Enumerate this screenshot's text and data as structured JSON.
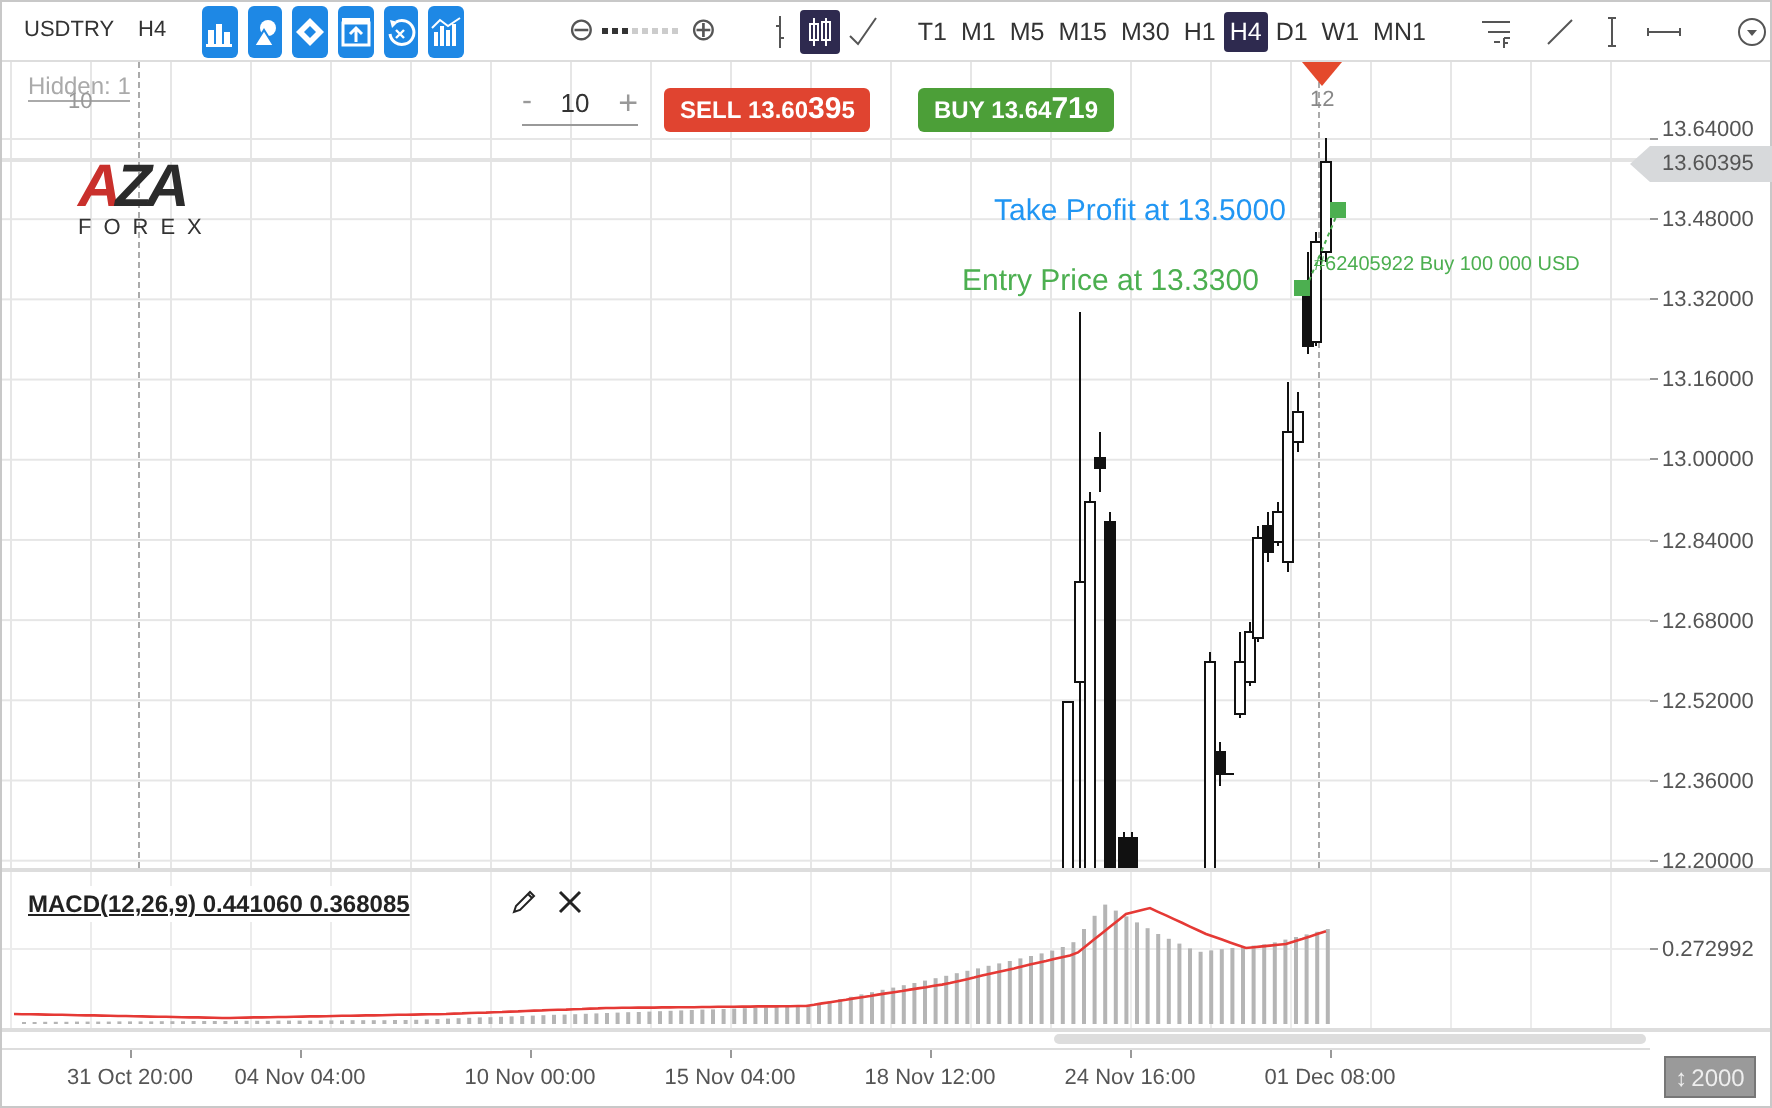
{
  "toolbar": {
    "symbol": "USDTRY",
    "timeframe": "H4",
    "tool_buttons": [
      {
        "kind": "bars"
      },
      {
        "kind": "shapes"
      },
      {
        "kind": "diamond"
      },
      {
        "kind": "upload"
      },
      {
        "kind": "refresh"
      },
      {
        "kind": "indicators"
      }
    ],
    "zoom": {
      "minus": "⊖",
      "plus": "⊕",
      "level": 0.375
    },
    "chart_types": [
      {
        "kind": "bar",
        "selected": false
      },
      {
        "kind": "candle",
        "selected": true
      },
      {
        "kind": "line",
        "selected": false
      }
    ],
    "timeframes": [
      {
        "label": "T1",
        "selected": false
      },
      {
        "label": "M1",
        "selected": false
      },
      {
        "label": "M5",
        "selected": false
      },
      {
        "label": "M15",
        "selected": false
      },
      {
        "label": "M30",
        "selected": false
      },
      {
        "label": "H1",
        "selected": false
      },
      {
        "label": "H4",
        "selected": true
      },
      {
        "label": "D1",
        "selected": false
      },
      {
        "label": "W1",
        "selected": false
      },
      {
        "label": "MN1",
        "selected": false
      }
    ],
    "drawing_tools": [
      {
        "kind": "text-lines"
      },
      {
        "kind": "trend-line"
      },
      {
        "kind": "vertical-line"
      },
      {
        "kind": "horizontal-line"
      },
      {
        "kind": "target"
      }
    ]
  },
  "chart": {
    "hidden": "Hidden: 1",
    "period_marker": "10",
    "logo": {
      "mark": "AZA",
      "name": "FOREX"
    },
    "lot": {
      "minus": "-",
      "value": "10",
      "plus": "+"
    },
    "sell": {
      "label": "SELL",
      "price_main": "13.60",
      "price_pips": "39",
      "price_tail": "5"
    },
    "buy": {
      "label": "BUY",
      "price_main": "13.64",
      "price_pips": "71",
      "price_tail": "9"
    },
    "current_marker": "12",
    "take_profit": "Take Profit at 13.5000",
    "entry_price": "Entry Price at 13.3300",
    "order": "#62405922 Buy 100 000 USD",
    "current_price": "13.60395",
    "price_axis": [
      "13.64000",
      "13.48000",
      "13.32000",
      "13.16000",
      "13.00000",
      "12.84000",
      "12.68000",
      "12.52000",
      "12.36000",
      "12.20000"
    ]
  },
  "macd": {
    "label": "MACD(12,26,9) 0.441060 0.368085",
    "axis": "0.272992"
  },
  "time_axis": [
    "31 Oct 20:00",
    "04 Nov 04:00",
    "10 Nov 00:00",
    "15 Nov 04:00",
    "18 Nov 12:00",
    "24 Nov 16:00",
    "01 Dec 08:00"
  ],
  "scale_button": {
    "icon": "↕",
    "label": "2000"
  }
}
